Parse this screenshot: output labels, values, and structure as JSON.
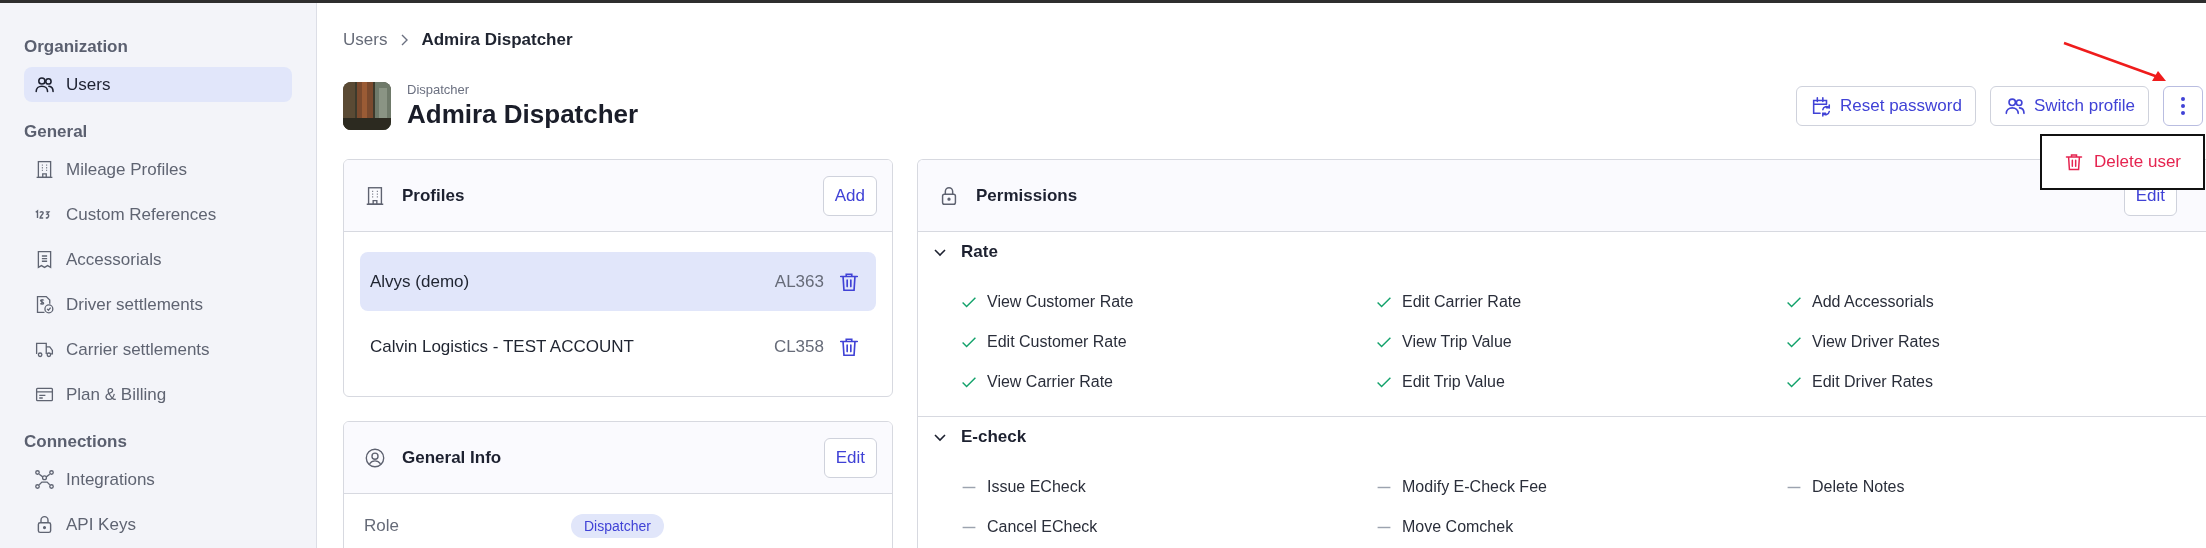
{
  "sidebar": {
    "sections": [
      {
        "title": "Organization",
        "items": [
          {
            "label": "Users",
            "kind": "users",
            "selected": true
          }
        ]
      },
      {
        "title": "General",
        "items": [
          {
            "label": "Mileage Profiles",
            "kind": "building",
            "selected": false
          },
          {
            "label": "Custom References",
            "kind": "numbers",
            "selected": false
          },
          {
            "label": "Accessorials",
            "kind": "receipt",
            "selected": false
          },
          {
            "label": "Driver settlements",
            "kind": "settlement",
            "selected": false
          },
          {
            "label": "Carrier settlements",
            "kind": "truck",
            "selected": false
          },
          {
            "label": "Plan & Billing",
            "kind": "card",
            "selected": false
          }
        ]
      },
      {
        "title": "Connections",
        "items": [
          {
            "label": "Integrations",
            "kind": "network",
            "selected": false
          },
          {
            "label": "API Keys",
            "kind": "lock",
            "selected": false
          }
        ]
      }
    ]
  },
  "breadcrumb": [
    "Users",
    "Admira Dispatcher"
  ],
  "user": {
    "role": "Dispatcher",
    "name": "Admira Dispatcher"
  },
  "actions": [
    {
      "label": "Reset password",
      "kind": "reset"
    },
    {
      "label": "Switch profile",
      "kind": "users"
    }
  ],
  "more_menu": {
    "expanded": true,
    "items": [
      {
        "label": "Delete user",
        "kind": "delete"
      }
    ]
  },
  "profiles": {
    "title": "Profiles",
    "action": "Add",
    "items": [
      {
        "name": "Alvys (demo)",
        "code": "AL363",
        "selected": true
      },
      {
        "name": "Calvin Logistics - TEST ACCOUNT",
        "code": "CL358",
        "selected": false
      }
    ]
  },
  "general_info": {
    "title": "General Info",
    "action": "Edit",
    "fields": [
      {
        "label": "Role",
        "value": "Dispatcher"
      }
    ]
  },
  "permissions": {
    "title": "Permissions",
    "action": "Edit",
    "groups": [
      {
        "title": "Rate",
        "expanded": true,
        "items": [
          {
            "label": "View Customer Rate",
            "granted": true
          },
          {
            "label": "Edit Carrier Rate",
            "granted": true
          },
          {
            "label": "Add Accessorials",
            "granted": true
          },
          {
            "label": "Edit Customer Rate",
            "granted": true
          },
          {
            "label": "View Trip Value",
            "granted": true
          },
          {
            "label": "View Driver Rates",
            "granted": true
          },
          {
            "label": "View Carrier Rate",
            "granted": true
          },
          {
            "label": "Edit Trip Value",
            "granted": true
          },
          {
            "label": "Edit Driver Rates",
            "granted": true
          }
        ]
      },
      {
        "title": "E-check",
        "expanded": true,
        "items": [
          {
            "label": "Issue ECheck",
            "granted": false
          },
          {
            "label": "Modify E-Check Fee",
            "granted": false
          },
          {
            "label": "Delete Notes",
            "granted": false
          },
          {
            "label": "Cancel ECheck",
            "granted": false
          },
          {
            "label": "Move Comchek",
            "granted": false
          }
        ]
      }
    ]
  }
}
